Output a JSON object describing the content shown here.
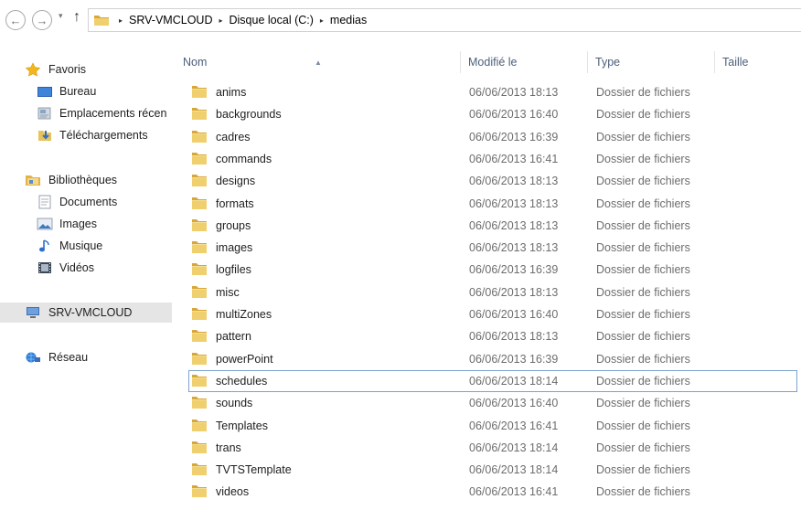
{
  "nav": {
    "back_glyph": "←",
    "forward_glyph": "→",
    "history_glyph": "▾",
    "up_glyph": "↑",
    "separator_glyph": "▸",
    "breadcrumbs": [
      "SRV-VMCLOUD",
      "Disque local (C:)",
      "medias"
    ]
  },
  "sidebar": {
    "items": [
      {
        "label": "Favoris",
        "icon": "star-icon",
        "kind": "group"
      },
      {
        "label": "Bureau",
        "icon": "desktop-icon",
        "kind": "child"
      },
      {
        "label": "Emplacements récen",
        "icon": "recent-places-icon",
        "kind": "child"
      },
      {
        "label": "Téléchargements",
        "icon": "downloads-icon",
        "kind": "child"
      },
      {
        "label": "Bibliothèques",
        "icon": "libraries-icon",
        "kind": "group"
      },
      {
        "label": "Documents",
        "icon": "documents-icon",
        "kind": "child"
      },
      {
        "label": "Images",
        "icon": "pictures-icon",
        "kind": "child"
      },
      {
        "label": "Musique",
        "icon": "music-icon",
        "kind": "child"
      },
      {
        "label": "Vidéos",
        "icon": "videos-icon",
        "kind": "child"
      },
      {
        "label": "SRV-VMCLOUD",
        "icon": "computer-icon",
        "kind": "group",
        "selected": true
      },
      {
        "label": "Réseau",
        "icon": "network-icon",
        "kind": "group"
      }
    ]
  },
  "columns": {
    "name": "Nom",
    "modified": "Modifié le",
    "type": "Type",
    "size": "Taille",
    "sort_glyph": "▲"
  },
  "files": [
    {
      "name": "anims",
      "modified": "06/06/2013 18:13",
      "type": "Dossier de fichiers",
      "size": ""
    },
    {
      "name": "backgrounds",
      "modified": "06/06/2013 16:40",
      "type": "Dossier de fichiers",
      "size": ""
    },
    {
      "name": "cadres",
      "modified": "06/06/2013 16:39",
      "type": "Dossier de fichiers",
      "size": ""
    },
    {
      "name": "commands",
      "modified": "06/06/2013 16:41",
      "type": "Dossier de fichiers",
      "size": ""
    },
    {
      "name": "designs",
      "modified": "06/06/2013 18:13",
      "type": "Dossier de fichiers",
      "size": ""
    },
    {
      "name": "formats",
      "modified": "06/06/2013 18:13",
      "type": "Dossier de fichiers",
      "size": ""
    },
    {
      "name": "groups",
      "modified": "06/06/2013 18:13",
      "type": "Dossier de fichiers",
      "size": ""
    },
    {
      "name": "images",
      "modified": "06/06/2013 18:13",
      "type": "Dossier de fichiers",
      "size": ""
    },
    {
      "name": "logfiles",
      "modified": "06/06/2013 16:39",
      "type": "Dossier de fichiers",
      "size": ""
    },
    {
      "name": "misc",
      "modified": "06/06/2013 18:13",
      "type": "Dossier de fichiers",
      "size": ""
    },
    {
      "name": "multiZones",
      "modified": "06/06/2013 16:40",
      "type": "Dossier de fichiers",
      "size": ""
    },
    {
      "name": "pattern",
      "modified": "06/06/2013 18:13",
      "type": "Dossier de fichiers",
      "size": ""
    },
    {
      "name": "powerPoint",
      "modified": "06/06/2013 16:39",
      "type": "Dossier de fichiers",
      "size": ""
    },
    {
      "name": "schedules",
      "modified": "06/06/2013 18:14",
      "type": "Dossier de fichiers",
      "size": "",
      "selected": true
    },
    {
      "name": "sounds",
      "modified": "06/06/2013 16:40",
      "type": "Dossier de fichiers",
      "size": ""
    },
    {
      "name": "Templates",
      "modified": "06/06/2013 16:41",
      "type": "Dossier de fichiers",
      "size": ""
    },
    {
      "name": "trans",
      "modified": "06/06/2013 18:14",
      "type": "Dossier de fichiers",
      "size": ""
    },
    {
      "name": "TVTSTemplate",
      "modified": "06/06/2013 18:14",
      "type": "Dossier de fichiers",
      "size": ""
    },
    {
      "name": "videos",
      "modified": "06/06/2013 16:41",
      "type": "Dossier de fichiers",
      "size": ""
    }
  ],
  "colors": {
    "folder": "#e8c25a",
    "folder_dark": "#d7a73a",
    "header_text": "#4c607a",
    "selection_border": "#7da2ce",
    "sidebar_selected": "#e5e5e5",
    "muted_text": "#6d6d6d"
  }
}
